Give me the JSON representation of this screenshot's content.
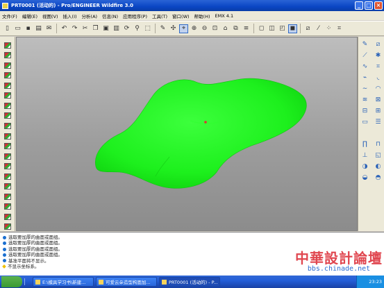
{
  "window": {
    "title": "PRT0001 (活动的) - Pro/ENGINEER Wildfire 3.0"
  },
  "menu": [
    "文件(F)",
    "编辑(E)",
    "视图(V)",
    "插入(I)",
    "分析(A)",
    "信息(N)",
    "应用程序(P)",
    "工具(T)",
    "窗口(W)",
    "帮助(H)",
    "EMX 4.1"
  ],
  "messages": [
    {
      "type": "info",
      "text": "选取要加厚的曲面或面组。"
    },
    {
      "type": "info",
      "text": "选取要加厚的曲面或面组。"
    },
    {
      "type": "info",
      "text": "选取要加厚的曲面或面组。"
    },
    {
      "type": "info",
      "text": "选取要加厚的曲面或面组。"
    },
    {
      "type": "info",
      "text": "基准平面将不显示。"
    },
    {
      "type": "warn",
      "text": "不显示坐标系。"
    }
  ],
  "watermark": {
    "text": "中華設計論壇",
    "url": "bbs.chinade.net"
  },
  "taskbar": {
    "items": [
      {
        "label": "E:\\模具学习书\\新建..."
      },
      {
        "label": "可爱云朵造型构面加..."
      },
      {
        "label": "PRT0001 (活动的) - P..."
      }
    ],
    "clock": "23:23"
  },
  "colors": {
    "model": "#19f019",
    "titlebar": "#0a46c4"
  }
}
